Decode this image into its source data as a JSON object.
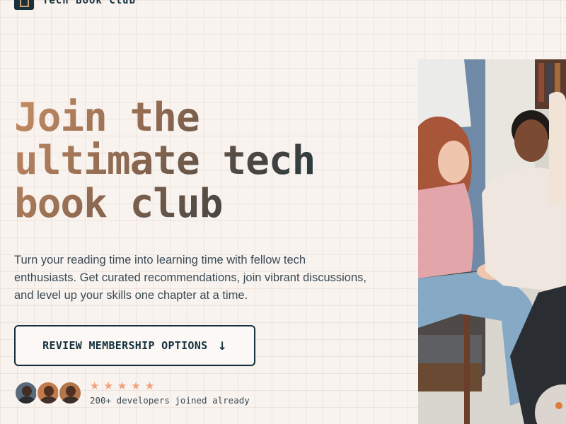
{
  "brand": {
    "name": "Tech Book Club"
  },
  "hero": {
    "title_lines": [
      "Join the",
      "ultimate tech",
      "book club"
    ],
    "subtitle": "Turn your reading time into learning time with fellow tech enthusiasts. Get curated recommendations, join vibrant discussions, and level up your skills one chapter at a time."
  },
  "cta": {
    "label": "REVIEW MEMBERSHIP OPTIONS",
    "icon": "arrow-down-icon"
  },
  "social_proof": {
    "rating_stars": 5,
    "caption": "200+ developers joined already"
  },
  "colors": {
    "background": "#f8f3ef",
    "primary": "#16313d",
    "accent": "#c68d63",
    "star": "#f2a179"
  }
}
